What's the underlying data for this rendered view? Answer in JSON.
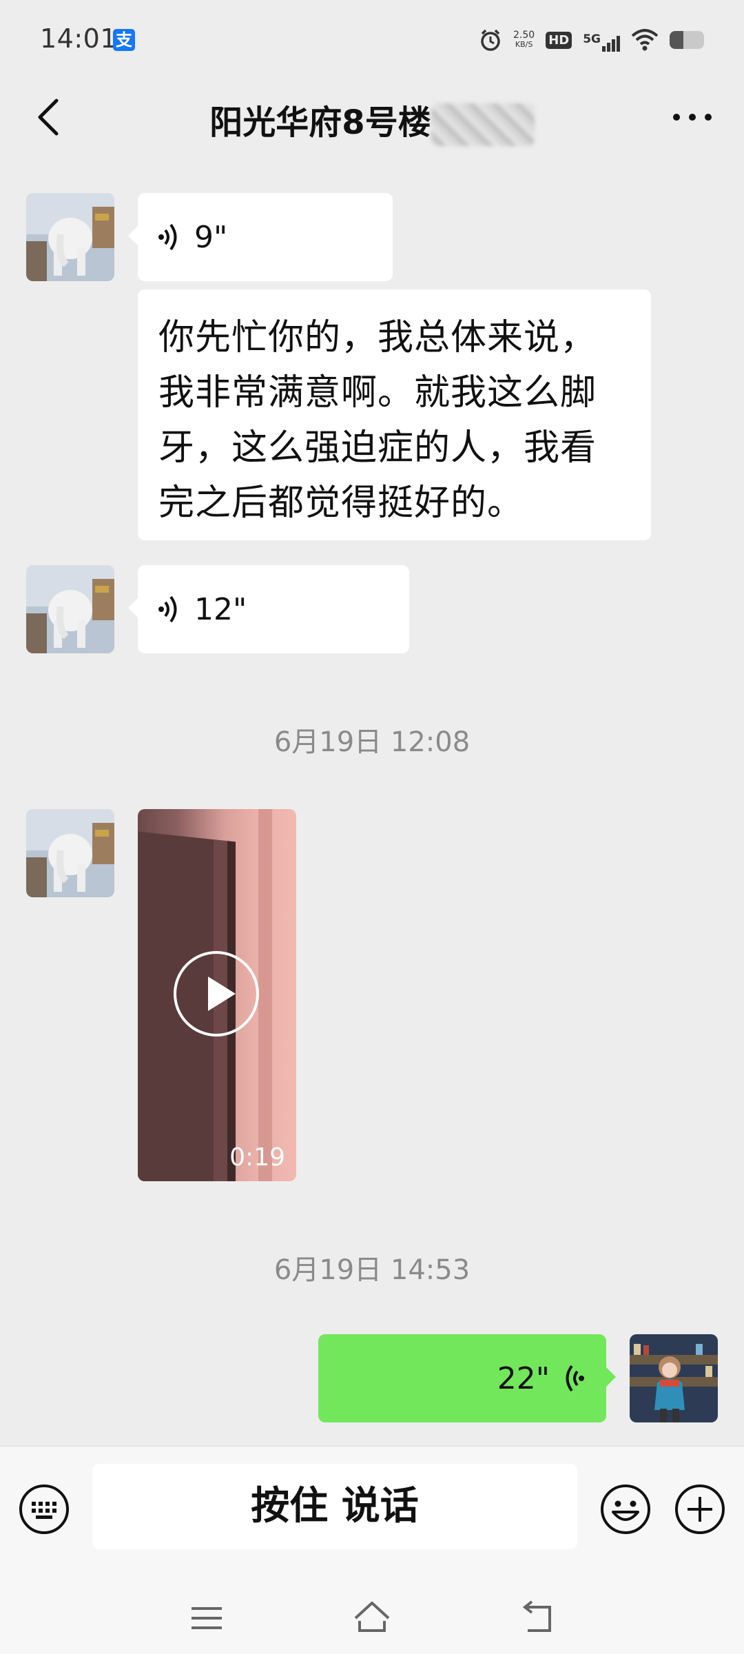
{
  "status_bar": {
    "time": "14:01",
    "alipay_icon_label": "支",
    "net_speed_value": "2.50",
    "net_speed_unit": "KB/S",
    "hd_label": "HD",
    "network_label": "5G",
    "battery_level": 0.4
  },
  "header": {
    "title": "阳光华府8号楼"
  },
  "messages": {
    "voice_1": {
      "duration": "9\""
    },
    "text_1": {
      "text": "你先忙你的，我总体来说，我非常满意啊。就我这么脚牙，这么强迫症的人，我看完之后都觉得挺好的。"
    },
    "voice_2": {
      "duration": "12\""
    },
    "timestamp_1": "6月19日 12:08",
    "video_1": {
      "duration": "0:19"
    },
    "timestamp_2": "6月19日 14:53",
    "voice_3": {
      "duration": "22\""
    }
  },
  "input_bar": {
    "hold_to_talk_label": "按住 说话"
  },
  "colors": {
    "background": "#ededed",
    "bubble_white": "#ffffff",
    "bubble_green": "#72e75c",
    "timestamp_text": "#8a8a8a"
  },
  "icons": [
    "back-arrow-icon",
    "more-icon",
    "voice-wave-icon",
    "play-icon",
    "keyboard-icon",
    "emoji-icon",
    "plus-icon",
    "menu-icon",
    "home-icon",
    "back-nav-icon",
    "alarm-icon",
    "wifi-icon",
    "signal-icon",
    "battery-icon"
  ]
}
